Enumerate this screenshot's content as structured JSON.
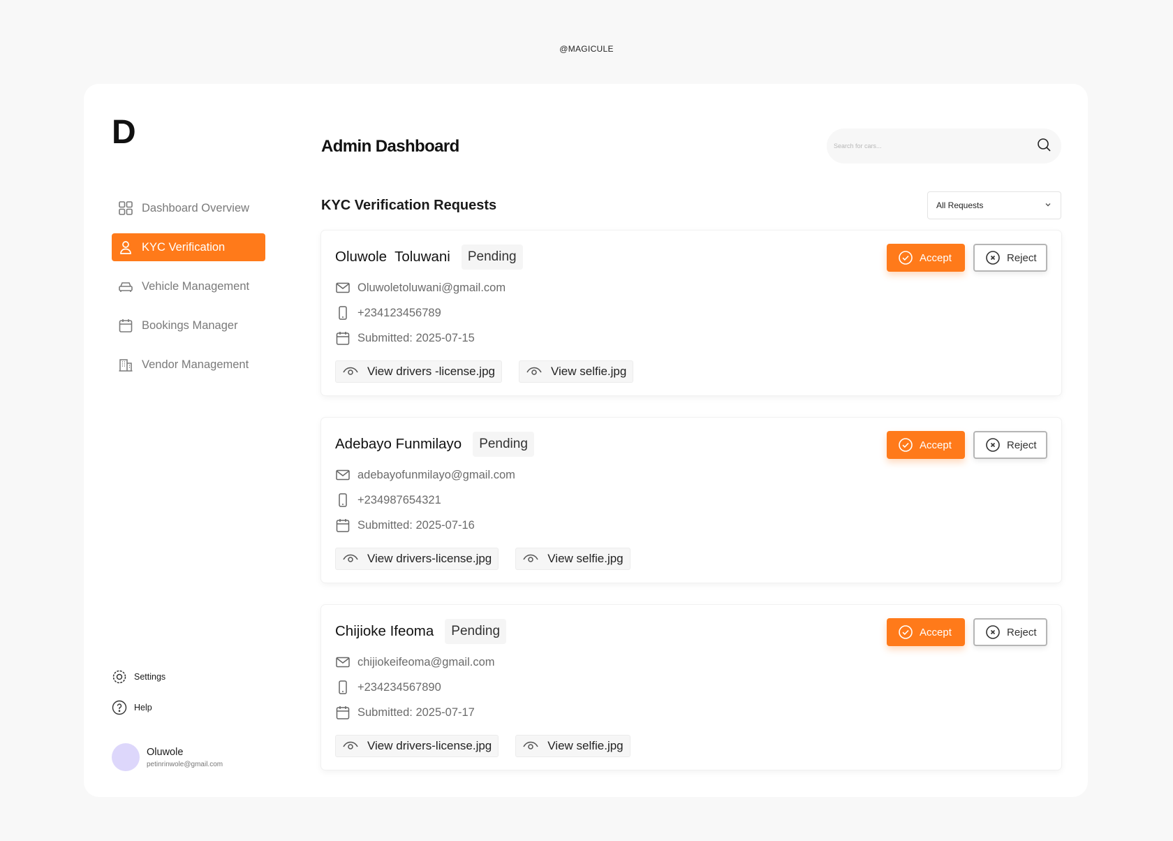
{
  "watermark": "@MAGICULE",
  "logo": "D",
  "header": {
    "title": "Admin Dashboard",
    "search_placeholder": "Search for cars..."
  },
  "sidebar": {
    "items": [
      {
        "label": "Dashboard Overview",
        "icon": "grid-icon",
        "active": false
      },
      {
        "label": "KYC Verification",
        "icon": "user-icon",
        "active": true
      },
      {
        "label": "Vehicle Management",
        "icon": "car-icon",
        "active": false
      },
      {
        "label": "Bookings Manager",
        "icon": "calendar-icon",
        "active": false
      },
      {
        "label": "Vendor Management",
        "icon": "building-icon",
        "active": false
      }
    ],
    "bottom": [
      {
        "label": "Settings",
        "icon": "gear-icon"
      },
      {
        "label": "Help",
        "icon": "help-icon"
      }
    ],
    "profile": {
      "name": "Oluwole",
      "email": "petinrinwole@gmail.com"
    }
  },
  "section": {
    "title": "KYC Verification Requests",
    "filter_selected": "All Requests"
  },
  "actions": {
    "accept": "Accept",
    "reject": "Reject"
  },
  "colors": {
    "accent": "#ff7a1a",
    "avatar": "#ddd7fb"
  },
  "requests": [
    {
      "name": "Oluwole  Toluwani",
      "status": "Pending",
      "email": "Oluwoletoluwani@gmail.com",
      "phone": "+234123456789",
      "submitted": "Submitted: 2025-07-15",
      "files": [
        "View drivers -license.jpg",
        "View selfie.jpg"
      ]
    },
    {
      "name": "Adebayo Funmilayo",
      "status": "Pending",
      "email": "adebayofunmilayo@gmail.com",
      "phone": "+234987654321",
      "submitted": "Submitted: 2025-07-16",
      "files": [
        "View drivers-license.jpg",
        "View selfie.jpg"
      ]
    },
    {
      "name": "Chijioke Ifeoma",
      "status": "Pending",
      "email": "chijiokeifeoma@gmail.com",
      "phone": "+234234567890",
      "submitted": "Submitted: 2025-07-17",
      "files": [
        "View drivers-license.jpg",
        "View selfie.jpg"
      ]
    }
  ]
}
